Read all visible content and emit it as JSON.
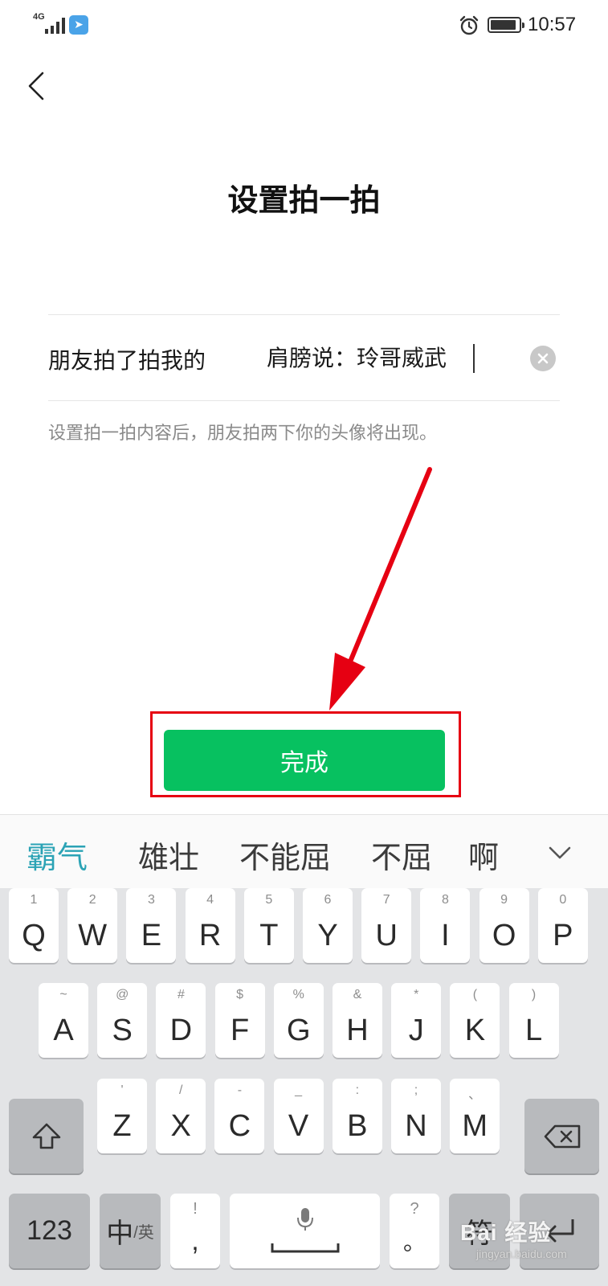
{
  "status_bar": {
    "network": "4G",
    "time": "10:57",
    "battery_level": 0.9
  },
  "page": {
    "title": "设置拍一拍",
    "prefix": "朋友拍了拍我的",
    "input_value": "肩膀说：玲哥威武",
    "hint": "设置拍一拍内容后，朋友拍两下你的头像将出现。",
    "done_label": "完成"
  },
  "keyboard": {
    "candidates": [
      "霸气",
      "雄壮",
      "不能屈",
      "不屈",
      "啊"
    ],
    "row1": [
      {
        "num": "1",
        "ch": "Q"
      },
      {
        "num": "2",
        "ch": "W"
      },
      {
        "num": "3",
        "ch": "E"
      },
      {
        "num": "4",
        "ch": "R"
      },
      {
        "num": "5",
        "ch": "T"
      },
      {
        "num": "6",
        "ch": "Y"
      },
      {
        "num": "7",
        "ch": "U"
      },
      {
        "num": "8",
        "ch": "I"
      },
      {
        "num": "9",
        "ch": "O"
      },
      {
        "num": "0",
        "ch": "P"
      }
    ],
    "row2": [
      {
        "num": "~",
        "ch": "A"
      },
      {
        "num": "@",
        "ch": "S"
      },
      {
        "num": "#",
        "ch": "D"
      },
      {
        "num": "$",
        "ch": "F"
      },
      {
        "num": "%",
        "ch": "G"
      },
      {
        "num": "&",
        "ch": "H"
      },
      {
        "num": "*",
        "ch": "J"
      },
      {
        "num": "(",
        "ch": "K"
      },
      {
        "num": ")",
        "ch": "L"
      }
    ],
    "row3": [
      {
        "num": "'",
        "ch": "Z"
      },
      {
        "num": "/",
        "ch": "X"
      },
      {
        "num": "-",
        "ch": "C"
      },
      {
        "num": "_",
        "ch": "V"
      },
      {
        "num": ":",
        "ch": "B"
      },
      {
        "num": ";",
        "ch": "N"
      },
      {
        "num": "、",
        "ch": "M"
      }
    ],
    "num_key": "123",
    "lang_key_main": "中",
    "lang_key_sub": "/英",
    "punct_key_top": "!",
    "punct_key_bottom": ",",
    "period_key_top": "?",
    "period_key_bottom": "。",
    "symbol_key": "符"
  },
  "watermark": {
    "main": "Bai 经验",
    "sub": "jingyan.baidu.com"
  },
  "colors": {
    "accent_green": "#07c160",
    "annotation_red": "#e60012",
    "candidate_highlight": "#2ba3b5"
  }
}
